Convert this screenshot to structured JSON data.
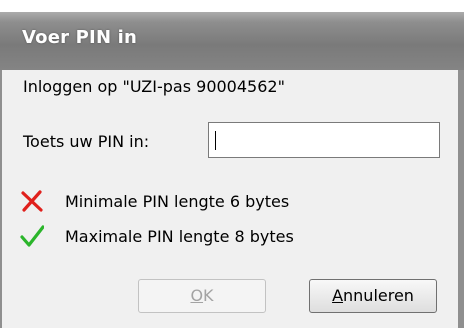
{
  "window": {
    "title": "Voer PIN in"
  },
  "login_text": "Inloggen op \"UZI-pas 90004562\"",
  "pin": {
    "label": "Toets uw PIN in:",
    "value": ""
  },
  "rules": [
    {
      "icon": "red-x-icon",
      "text": "Minimale PIN lengte 6 bytes",
      "status": "fail",
      "color": "#e0201c"
    },
    {
      "icon": "green-check-icon",
      "text": "Maximale PIN lengte 8 bytes",
      "status": "pass",
      "color": "#2bb52b"
    }
  ],
  "buttons": {
    "ok": {
      "mnemonic": "O",
      "rest": "K",
      "enabled": false
    },
    "cancel": {
      "mnemonic": "A",
      "rest": "nnuleren",
      "enabled": true
    }
  }
}
